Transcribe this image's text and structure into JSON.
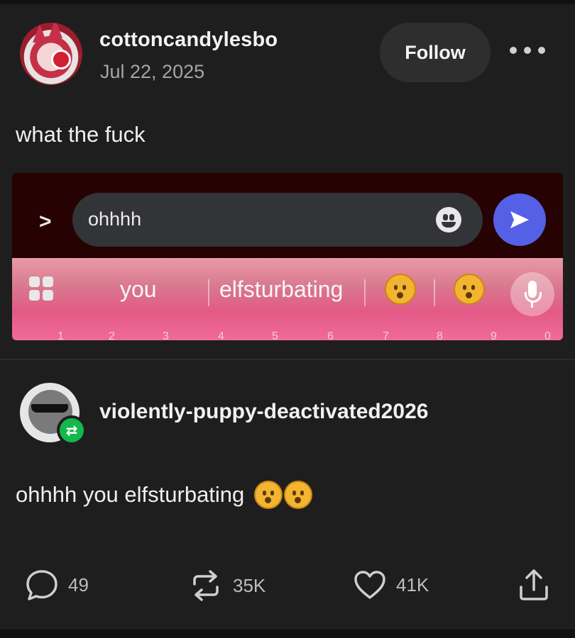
{
  "post": {
    "author": "cottoncandylesbo",
    "date": "Jul 22, 2025",
    "follow_label": "Follow",
    "text": "what the fuck"
  },
  "screenshot": {
    "message_text": "ohhhh",
    "suggestions": [
      "you",
      "elfsturbating"
    ],
    "number_row": [
      "1",
      "2",
      "3",
      "4",
      "5",
      "6",
      "7",
      "8",
      "9",
      "0"
    ],
    "icons": [
      "chevron-right-icon",
      "emoji-icon",
      "send-icon",
      "apps-grid-icon",
      "worried-face-emoji",
      "astonished-face-emoji",
      "microphone-icon"
    ]
  },
  "reblog": {
    "username": "violently-puppy-deactivated2026",
    "text": "ohhhh you elfsturbating"
  },
  "footer": {
    "comments": "49",
    "reblogs": "35K",
    "likes": "41K"
  },
  "colors": {
    "background": "#1e1e1e",
    "send_button": "#5460e6",
    "reblog_badge": "#14b84a"
  }
}
